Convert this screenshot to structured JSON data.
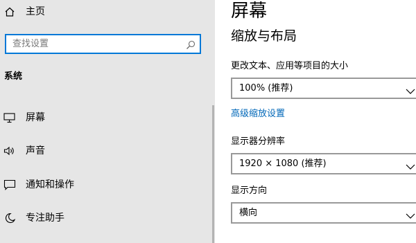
{
  "sidebar": {
    "home_label": "主页",
    "search_placeholder": "查找设置",
    "section_title": "系统",
    "items": [
      {
        "label": "屏幕",
        "icon": "monitor-icon"
      },
      {
        "label": "声音",
        "icon": "speaker-icon"
      },
      {
        "label": "通知和操作",
        "icon": "notification-icon"
      },
      {
        "label": "专注助手",
        "icon": "moon-icon"
      }
    ]
  },
  "main": {
    "title": "屏幕",
    "subtitle": "缩放与布局",
    "scale_label": "更改文本、应用等项目的大小",
    "scale_value": "100% (推荐)",
    "advanced_link": "高级缩放设置",
    "resolution_label": "显示器分辨率",
    "resolution_value": "1920 × 1080 (推荐)",
    "orientation_label": "显示方向",
    "orientation_value": "横向"
  },
  "colors": {
    "accent": "#0078d7",
    "link": "#0067b8",
    "sidebar_bg": "#e6e6e6"
  }
}
